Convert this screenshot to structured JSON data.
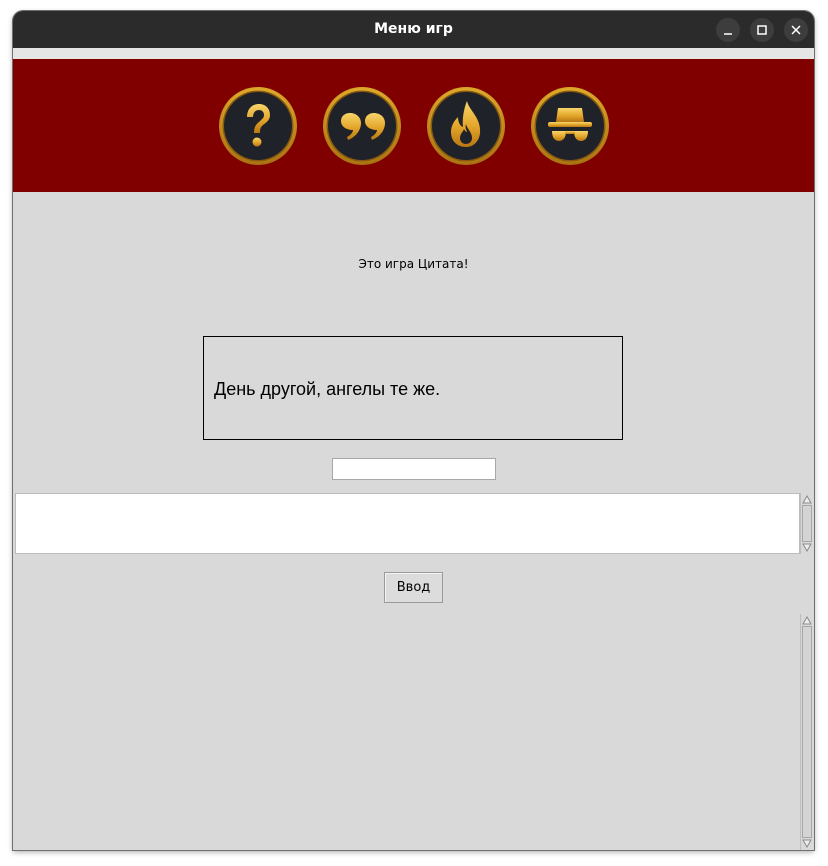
{
  "window": {
    "title": "Меню игр"
  },
  "games": [
    {
      "icon": "question-mark-icon"
    },
    {
      "icon": "quote-marks-icon"
    },
    {
      "icon": "fire-icon"
    },
    {
      "icon": "incognito-icon"
    }
  ],
  "main": {
    "intro_text": "Это игра Цитата!",
    "quote": "День другой, ангелы те же.",
    "answer_value": "",
    "enter_label": "Ввод"
  },
  "colors": {
    "banner": "#800000",
    "gold": "#e8b530",
    "icon_dark": "#1f2228",
    "background": "#d9d9d9"
  }
}
